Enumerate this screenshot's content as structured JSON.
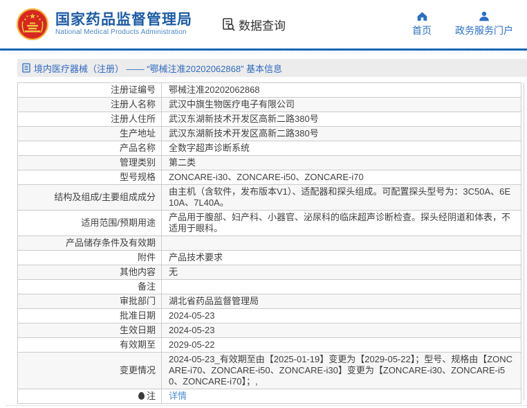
{
  "header": {
    "title": "国家药品监督管理局",
    "subtitle": "National Medical Products Administration",
    "data_query_label": "数据查询",
    "nav": [
      {
        "label": "首页",
        "icon": "home-icon"
      },
      {
        "label": "政务服务门户",
        "icon": "user-icon"
      }
    ]
  },
  "breadcrumb": {
    "text": "境内医疗器械（注册） —— “鄂械注准20202062868” 基本信息"
  },
  "table": {
    "rows": [
      {
        "label": "注册证编号",
        "value": "鄂械注准20202062868"
      },
      {
        "label": "注册人名称",
        "value": "武汉中旗生物医疗电子有限公司"
      },
      {
        "label": "注册人住所",
        "value": "武汉东湖新技术开发区高新二路380号"
      },
      {
        "label": "生产地址",
        "value": "武汉东湖新技术开发区高新二路380号"
      },
      {
        "label": "产品名称",
        "value": "全数字超声诊断系统"
      },
      {
        "label": "管理类别",
        "value": "第二类"
      },
      {
        "label": "型号规格",
        "value": "ZONCARE-i30、ZONCARE-i50、ZONCARE-i70"
      },
      {
        "label": "结构及组成/主要组成成分",
        "value": "由主机（含软件，发布版本V1）、适配器和探头组成。可配置探头型号为：3C50A、6E10A、7L40A。"
      },
      {
        "label": "适用范围/预期用途",
        "value": "产品用于腹部、妇产科、小器官、泌尿科的临床超声诊断检查。探头经阴道和体表，不适用于眼科。"
      },
      {
        "label": "产品储存条件及有效期",
        "value": ""
      },
      {
        "label": "附件",
        "value": "产品技术要求"
      },
      {
        "label": "其他内容",
        "value": "无"
      },
      {
        "label": "备注",
        "value": ""
      },
      {
        "label": "审批部门",
        "value": "湖北省药品监督管理局"
      },
      {
        "label": "批准日期",
        "value": "2024-05-23"
      },
      {
        "label": "生效日期",
        "value": "2024-05-23"
      },
      {
        "label": "有效期至",
        "value": "2029-05-22"
      },
      {
        "label": "变更情况",
        "value": "2024-05-23_有效期至由【2025-01-19】变更为【2029-05-22】；型号、规格由【ZONCARE-i70、ZONCARE-i50、ZONCARE-i30】变更为【ZONCARE-i30、ZONCARE-i50、ZONCARE-i70】；,"
      },
      {
        "label": "注",
        "value": "详情",
        "icon": "bulb-icon",
        "link": true
      }
    ]
  },
  "colors": {
    "brand_blue": "#1c5ba6",
    "nav_blue": "#2a6fc9",
    "breadcrumb_blue": "#2e6ac0",
    "link_blue": "#4a90d9",
    "separator_blue": "#1266b3",
    "breadcrumb_bg": "#ececec",
    "row_alt_bg": "#f7f7f7",
    "emblem_red": "#d6281e",
    "emblem_gold": "#f3c545"
  }
}
